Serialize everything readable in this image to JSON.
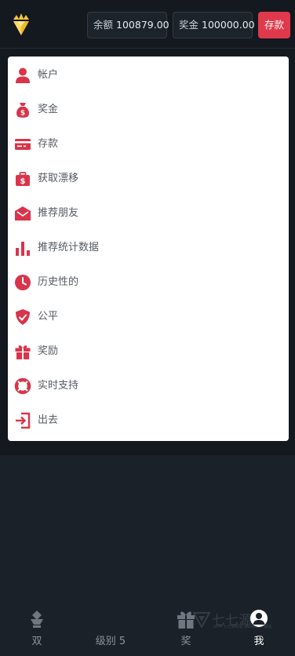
{
  "header": {
    "balance_label": "余额",
    "balance_value": "100879.00",
    "bonus_label": "奖金",
    "bonus_value": "100000.00",
    "deposit_label": "存款"
  },
  "menu": {
    "items": [
      {
        "label": "帐户",
        "icon": "user-icon"
      },
      {
        "label": "奖金",
        "icon": "money-bag-icon"
      },
      {
        "label": "存款",
        "icon": "credit-card-icon"
      },
      {
        "label": "获取漂移",
        "icon": "dollar-briefcase-icon"
      },
      {
        "label": "推荐朋友",
        "icon": "envelope-icon"
      },
      {
        "label": "推荐统计数据",
        "icon": "bar-chart-icon"
      },
      {
        "label": "历史性的",
        "icon": "clock-icon"
      },
      {
        "label": "公平",
        "icon": "shield-check-icon"
      },
      {
        "label": "奖励",
        "icon": "gift-icon"
      },
      {
        "label": "实时支持",
        "icon": "lifebuoy-icon"
      },
      {
        "label": "出去",
        "icon": "sign-out-icon"
      }
    ]
  },
  "bottom_nav": {
    "items": [
      {
        "label": "双",
        "icon": "diamond-cup-icon"
      },
      {
        "label": "级别 5",
        "icon": ""
      },
      {
        "label": "奖",
        "icon": "gift-icon"
      },
      {
        "label": "我",
        "icon": "avatar-icon"
      }
    ]
  },
  "watermark": {
    "text": "七七源码",
    "sub": "GYM 七七源码站 源码资源下载站"
  },
  "colors": {
    "accent": "#e0394b",
    "icon": "#d9344a",
    "bg": "#1b2128",
    "header_bg": "#14191f"
  }
}
